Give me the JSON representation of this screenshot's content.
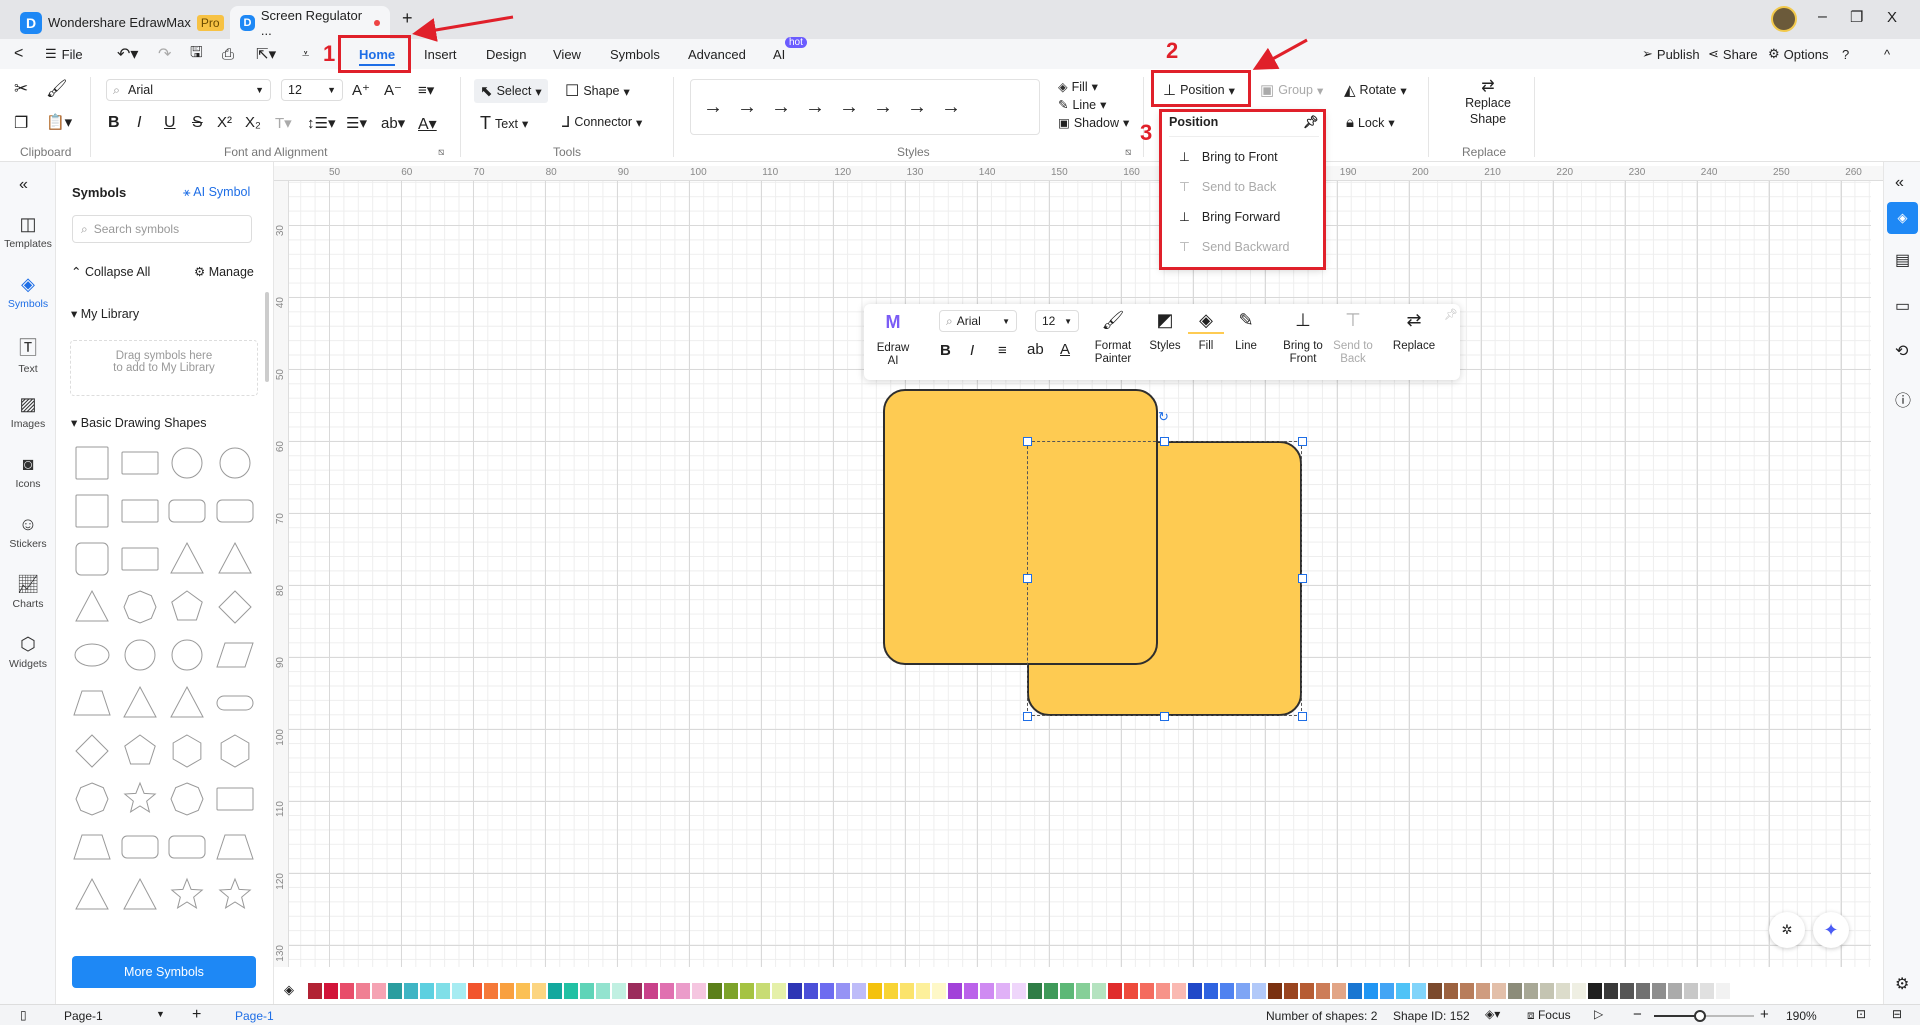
{
  "tabs": {
    "app_name": "Wondershare EdrawMax",
    "badge": "Pro",
    "doc_tab": "Screen Regulator ...",
    "new_tab": "+"
  },
  "window": {
    "minimize": "–",
    "restore": "❐",
    "close": "X"
  },
  "menu": {
    "back": "<",
    "file": "File",
    "items": [
      "Home",
      "Insert",
      "Design",
      "View",
      "Symbols",
      "Advanced",
      "AI"
    ],
    "hot": "hot",
    "active": "Home",
    "publish": "Publish",
    "share": "Share",
    "options": "Options",
    "help": "?",
    "collapse": "^"
  },
  "ribbon": {
    "font": "Arial",
    "size": "12",
    "select": "Select",
    "shape": "Shape",
    "text": "Text",
    "connector": "Connector",
    "fill": "Fill",
    "line": "Line",
    "shadow": "Shadow",
    "position": "Position",
    "group": "Group",
    "rotate": "Rotate",
    "lock": "Lock",
    "replace_shape": "Replace Shape",
    "groups": [
      "Clipboard",
      "Font and Alignment",
      "Tools",
      "Styles",
      "Replace"
    ]
  },
  "annotations": [
    "1",
    "2",
    "3"
  ],
  "position_menu": {
    "title": "Position",
    "items": [
      {
        "label": "Bring to Front",
        "enabled": true
      },
      {
        "label": "Send to Back",
        "enabled": false
      },
      {
        "label": "Bring Forward",
        "enabled": true
      },
      {
        "label": "Send Backward",
        "enabled": false
      }
    ]
  },
  "rail": [
    "Templates",
    "Symbols",
    "Text",
    "Images",
    "Icons",
    "Stickers",
    "Charts",
    "Widgets"
  ],
  "symbols": {
    "title": "Symbols",
    "ai_symbol": "AI Symbol",
    "search_placeholder": "Search symbols",
    "collapse_all": "Collapse All",
    "manage": "Manage",
    "my_library": "My Library",
    "drag_hint": "Drag symbols here\nto add to My Library",
    "basic_shapes": "Basic Drawing Shapes",
    "more_symbols": "More Symbols"
  },
  "ruler": {
    "top": [
      "50",
      "60",
      "70",
      "80",
      "90",
      "100",
      "110",
      "120",
      "130",
      "140",
      "150",
      "160",
      "170",
      "180",
      "190",
      "200",
      "210",
      "220",
      "230",
      "240",
      "250",
      "260"
    ],
    "left": [
      "30",
      "40",
      "50",
      "60",
      "70",
      "80",
      "90",
      "100",
      "110",
      "120",
      "130"
    ]
  },
  "floatbar": {
    "font": "Arial",
    "size": "12",
    "edraw_ai": "Edraw AI",
    "format_painter": "Format Painter",
    "styles": "Styles",
    "fill": "Fill",
    "line": "Line",
    "bring_to_front": "Bring to Front",
    "send_to_back": "Send to Back",
    "replace": "Replace"
  },
  "shape_fill": "#fecb52",
  "palette": [
    "#b22234",
    "#d2143a",
    "#e84d6a",
    "#f07f93",
    "#f5a3b3",
    "#2a9d9f",
    "#3fb5c4",
    "#5dd0e0",
    "#80dfe8",
    "#a7ecf2",
    "#f2542d",
    "#f5793a",
    "#f9a03f",
    "#fbc054",
    "#fcd581",
    "#13a89e",
    "#22c1a4",
    "#5fd4b8",
    "#93e3cf",
    "#c1f0e2",
    "#9b2c5c",
    "#c9418a",
    "#e070b0",
    "#eb9cca",
    "#f5c6e0",
    "#5b7f1a",
    "#7da32b",
    "#a5c342",
    "#c8dc74",
    "#e5f0a9",
    "#2e35b5",
    "#4b4fd8",
    "#6d6cf0",
    "#9693f5",
    "#bebcf9",
    "#f4c20d",
    "#f8d435",
    "#fbe36c",
    "#fdf09b",
    "#fef8c8",
    "#a241d9",
    "#bb62ea",
    "#cf8af2",
    "#e0b1f7",
    "#efd6fb",
    "#2f7d46",
    "#3f9a5a",
    "#5db877",
    "#86cf98",
    "#b5e3c0",
    "#e02c2c",
    "#ee4a3c",
    "#f46b5e",
    "#f79389",
    "#fab9b2",
    "#2048c8",
    "#2f63e0",
    "#4f82f0",
    "#7ea5f5",
    "#b2c9f9",
    "#7a3110",
    "#9a4520",
    "#b65c33",
    "#cd7d58",
    "#e2a586",
    "#1976d2",
    "#2196f3",
    "#42a5f5",
    "#4fc3f7",
    "#81d4fa",
    "#7b4a2d",
    "#9c6240",
    "#b87d5b",
    "#cf9c7f",
    "#e3bfa9",
    "#8c8c7a",
    "#a8a896",
    "#c4c4b2",
    "#dcdccb",
    "#efefe3",
    "#1f1f1f",
    "#3a3a3a",
    "#555555",
    "#717171",
    "#8e8e8e",
    "#ababab",
    "#c8c8c8",
    "#e0e0e0",
    "#f2f2f2"
  ],
  "status": {
    "page_select": "Page-1",
    "add_page": "+",
    "active_page": "Page-1",
    "shapes": "Number of shapes: 2",
    "shape_id": "Shape ID: 152",
    "focus": "Focus",
    "zoom": "190%",
    "zoom_level": 190
  }
}
